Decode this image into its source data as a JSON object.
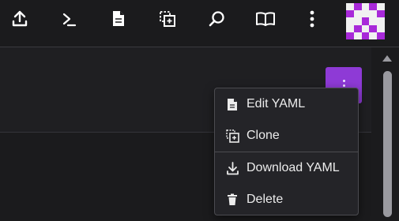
{
  "toolbar": {
    "buttons": [
      {
        "icon": "upload-icon"
      },
      {
        "icon": "terminal-icon"
      },
      {
        "icon": "file-icon"
      },
      {
        "icon": "clone-icon"
      },
      {
        "icon": "search-icon"
      },
      {
        "icon": "book-icon"
      },
      {
        "icon": "kebab-menu-icon"
      }
    ]
  },
  "colors": {
    "accent": "#8e3ad6",
    "avatar_purple": "#a829d9",
    "background": "#1b1b1d",
    "menu_bg": "#242428"
  },
  "context_menu": {
    "items": [
      {
        "label": "Edit YAML",
        "icon": "file-icon"
      },
      {
        "label": "Clone",
        "icon": "clone-icon"
      },
      {
        "label": "Download YAML",
        "icon": "download-icon"
      },
      {
        "label": "Delete",
        "icon": "trash-icon"
      }
    ]
  }
}
